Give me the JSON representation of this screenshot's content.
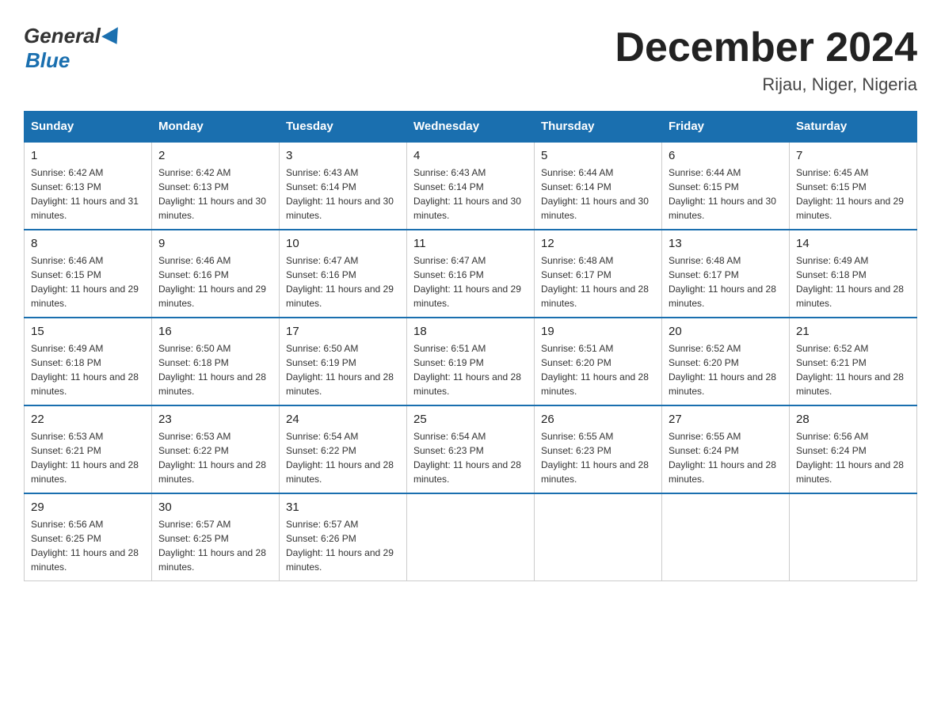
{
  "header": {
    "logo_general": "General",
    "logo_blue": "Blue",
    "month_title": "December 2024",
    "location": "Rijau, Niger, Nigeria"
  },
  "weekdays": [
    "Sunday",
    "Monday",
    "Tuesday",
    "Wednesday",
    "Thursday",
    "Friday",
    "Saturday"
  ],
  "weeks": [
    [
      {
        "day": "1",
        "sunrise": "6:42 AM",
        "sunset": "6:13 PM",
        "daylight": "11 hours and 31 minutes."
      },
      {
        "day": "2",
        "sunrise": "6:42 AM",
        "sunset": "6:13 PM",
        "daylight": "11 hours and 30 minutes."
      },
      {
        "day": "3",
        "sunrise": "6:43 AM",
        "sunset": "6:14 PM",
        "daylight": "11 hours and 30 minutes."
      },
      {
        "day": "4",
        "sunrise": "6:43 AM",
        "sunset": "6:14 PM",
        "daylight": "11 hours and 30 minutes."
      },
      {
        "day": "5",
        "sunrise": "6:44 AM",
        "sunset": "6:14 PM",
        "daylight": "11 hours and 30 minutes."
      },
      {
        "day": "6",
        "sunrise": "6:44 AM",
        "sunset": "6:15 PM",
        "daylight": "11 hours and 30 minutes."
      },
      {
        "day": "7",
        "sunrise": "6:45 AM",
        "sunset": "6:15 PM",
        "daylight": "11 hours and 29 minutes."
      }
    ],
    [
      {
        "day": "8",
        "sunrise": "6:46 AM",
        "sunset": "6:15 PM",
        "daylight": "11 hours and 29 minutes."
      },
      {
        "day": "9",
        "sunrise": "6:46 AM",
        "sunset": "6:16 PM",
        "daylight": "11 hours and 29 minutes."
      },
      {
        "day": "10",
        "sunrise": "6:47 AM",
        "sunset": "6:16 PM",
        "daylight": "11 hours and 29 minutes."
      },
      {
        "day": "11",
        "sunrise": "6:47 AM",
        "sunset": "6:16 PM",
        "daylight": "11 hours and 29 minutes."
      },
      {
        "day": "12",
        "sunrise": "6:48 AM",
        "sunset": "6:17 PM",
        "daylight": "11 hours and 28 minutes."
      },
      {
        "day": "13",
        "sunrise": "6:48 AM",
        "sunset": "6:17 PM",
        "daylight": "11 hours and 28 minutes."
      },
      {
        "day": "14",
        "sunrise": "6:49 AM",
        "sunset": "6:18 PM",
        "daylight": "11 hours and 28 minutes."
      }
    ],
    [
      {
        "day": "15",
        "sunrise": "6:49 AM",
        "sunset": "6:18 PM",
        "daylight": "11 hours and 28 minutes."
      },
      {
        "day": "16",
        "sunrise": "6:50 AM",
        "sunset": "6:18 PM",
        "daylight": "11 hours and 28 minutes."
      },
      {
        "day": "17",
        "sunrise": "6:50 AM",
        "sunset": "6:19 PM",
        "daylight": "11 hours and 28 minutes."
      },
      {
        "day": "18",
        "sunrise": "6:51 AM",
        "sunset": "6:19 PM",
        "daylight": "11 hours and 28 minutes."
      },
      {
        "day": "19",
        "sunrise": "6:51 AM",
        "sunset": "6:20 PM",
        "daylight": "11 hours and 28 minutes."
      },
      {
        "day": "20",
        "sunrise": "6:52 AM",
        "sunset": "6:20 PM",
        "daylight": "11 hours and 28 minutes."
      },
      {
        "day": "21",
        "sunrise": "6:52 AM",
        "sunset": "6:21 PM",
        "daylight": "11 hours and 28 minutes."
      }
    ],
    [
      {
        "day": "22",
        "sunrise": "6:53 AM",
        "sunset": "6:21 PM",
        "daylight": "11 hours and 28 minutes."
      },
      {
        "day": "23",
        "sunrise": "6:53 AM",
        "sunset": "6:22 PM",
        "daylight": "11 hours and 28 minutes."
      },
      {
        "day": "24",
        "sunrise": "6:54 AM",
        "sunset": "6:22 PM",
        "daylight": "11 hours and 28 minutes."
      },
      {
        "day": "25",
        "sunrise": "6:54 AM",
        "sunset": "6:23 PM",
        "daylight": "11 hours and 28 minutes."
      },
      {
        "day": "26",
        "sunrise": "6:55 AM",
        "sunset": "6:23 PM",
        "daylight": "11 hours and 28 minutes."
      },
      {
        "day": "27",
        "sunrise": "6:55 AM",
        "sunset": "6:24 PM",
        "daylight": "11 hours and 28 minutes."
      },
      {
        "day": "28",
        "sunrise": "6:56 AM",
        "sunset": "6:24 PM",
        "daylight": "11 hours and 28 minutes."
      }
    ],
    [
      {
        "day": "29",
        "sunrise": "6:56 AM",
        "sunset": "6:25 PM",
        "daylight": "11 hours and 28 minutes."
      },
      {
        "day": "30",
        "sunrise": "6:57 AM",
        "sunset": "6:25 PM",
        "daylight": "11 hours and 28 minutes."
      },
      {
        "day": "31",
        "sunrise": "6:57 AM",
        "sunset": "6:26 PM",
        "daylight": "11 hours and 29 minutes."
      },
      null,
      null,
      null,
      null
    ]
  ]
}
